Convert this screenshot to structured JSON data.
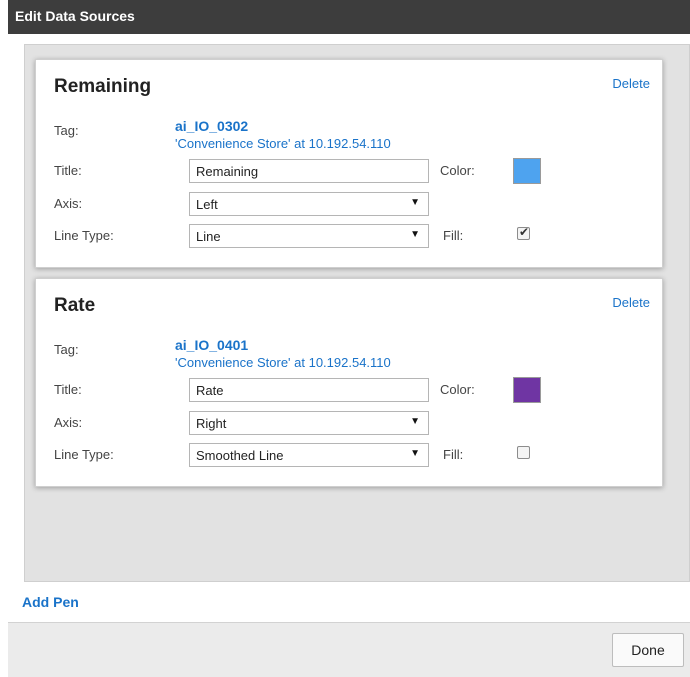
{
  "dialog": {
    "title": "Edit Data Sources"
  },
  "labels": {
    "tag": "Tag:",
    "title": "Title:",
    "axis": "Axis:",
    "line_type": "Line Type:",
    "color": "Color:",
    "fill": "Fill:",
    "delete": "Delete"
  },
  "pens": [
    {
      "heading": "Remaining",
      "tag_name": "ai_IO_0302",
      "tag_source": "'Convenience Store' at 10.192.54.110",
      "title_value": "Remaining",
      "axis": "Left",
      "line_type": "Line",
      "color": "#4ea3ef",
      "fill_checked": true
    },
    {
      "heading": "Rate",
      "tag_name": "ai_IO_0401",
      "tag_source": "'Convenience Store' at 10.192.54.110",
      "title_value": "Rate",
      "axis": "Right",
      "line_type": "Smoothed Line",
      "color": "#6f35a3",
      "fill_checked": false
    }
  ],
  "add_pen_label": "Add Pen",
  "footer": {
    "done_label": "Done"
  },
  "icons": {
    "select_caret": "▼",
    "check_mark": "✔"
  }
}
